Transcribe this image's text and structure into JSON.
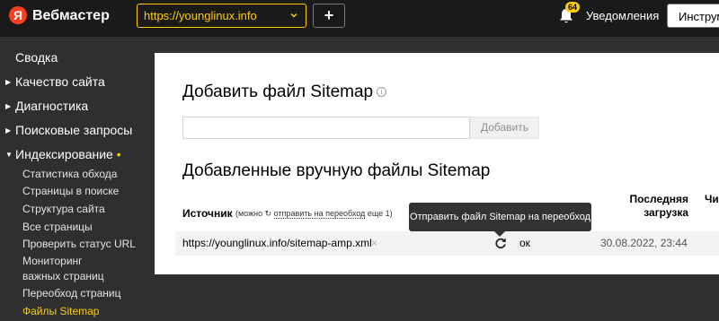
{
  "header": {
    "logo_letter": "Я",
    "app_title": "Вебмастер",
    "site_selector": {
      "value": "https://younglinux.info"
    },
    "add_site_label": "+",
    "notifications": {
      "count": "64",
      "label": "Уведомления"
    },
    "tools_label": "Инструменты"
  },
  "sidebar": {
    "items": [
      {
        "label": "Сводка"
      },
      {
        "label": "Качество сайта",
        "arrow": "▶"
      },
      {
        "label": "Диагностика",
        "arrow": "▶"
      },
      {
        "label": "Поисковые запросы",
        "arrow": "▶"
      },
      {
        "label": "Индексирование",
        "arrow": "▼",
        "dot": "•"
      }
    ],
    "subitems": [
      {
        "label": "Статистика обхода"
      },
      {
        "label": "Страницы в поиске"
      },
      {
        "label": "Структура сайта"
      },
      {
        "label": "Все страницы"
      },
      {
        "label": "Проверить статус URL"
      },
      {
        "label": "Мониторинг"
      },
      {
        "label": "важных страниц"
      },
      {
        "label": "Переобход страниц"
      },
      {
        "label": "Файлы Sitemap"
      }
    ]
  },
  "main": {
    "add_title": "Добавить файл Sitemap",
    "info_glyph": "i",
    "input_value": "",
    "add_button": "Добавить",
    "list_title": "Добавленные вручную файлы Sitemap",
    "table": {
      "col_source": "Источник",
      "col_source_note_pre": "(можно",
      "col_source_note_link": "отправить на переобход",
      "col_source_note_post": "еще 1)",
      "col_last_line1": "Последняя",
      "col_last_line2": "загрузка",
      "col_clipped": "Чи",
      "rows": [
        {
          "url": "https://younglinux.info/sitemap-amp.xml",
          "remove_glyph": "×",
          "status": "ок",
          "date": "30.08.2022, 23:44"
        }
      ]
    },
    "tooltip": "Отправить файл Sitemap на переобход"
  },
  "colors": {
    "brand": "#fc3f1d",
    "accent": "#ffcc00",
    "header_bg": "#1a1a1a",
    "sidebar_bg": "#2f2f2f"
  },
  "icons": [
    "yandex-logo-icon",
    "chevron-down-icon",
    "bell-icon",
    "info-icon",
    "refresh-icon",
    "close-icon"
  ]
}
